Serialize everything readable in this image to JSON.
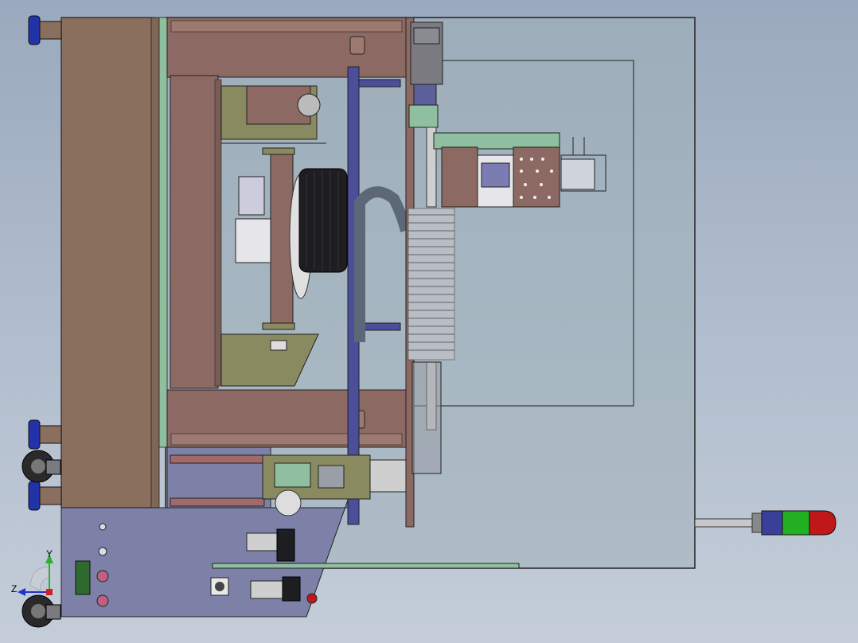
{
  "viewport": {
    "background_top": "#9aa9bd",
    "background_bottom": "#c4cdd9"
  },
  "triad": {
    "y_label": "Y",
    "z_label": "Z",
    "y_color": "#2bb02b",
    "z_color": "#2233cc",
    "x_color": "#d02020"
  },
  "stack_light": {
    "colors": [
      "#3a3f9a",
      "#22b022",
      "#c01818"
    ]
  },
  "palette": {
    "frame": "#8a6f5e",
    "plate": "#8c6a63",
    "glass": "#9fb0b8",
    "rail": "#4b4f9a",
    "olive": "#8a8a60",
    "green_trim": "#8fbf9f",
    "dark": "#1e1e22"
  }
}
